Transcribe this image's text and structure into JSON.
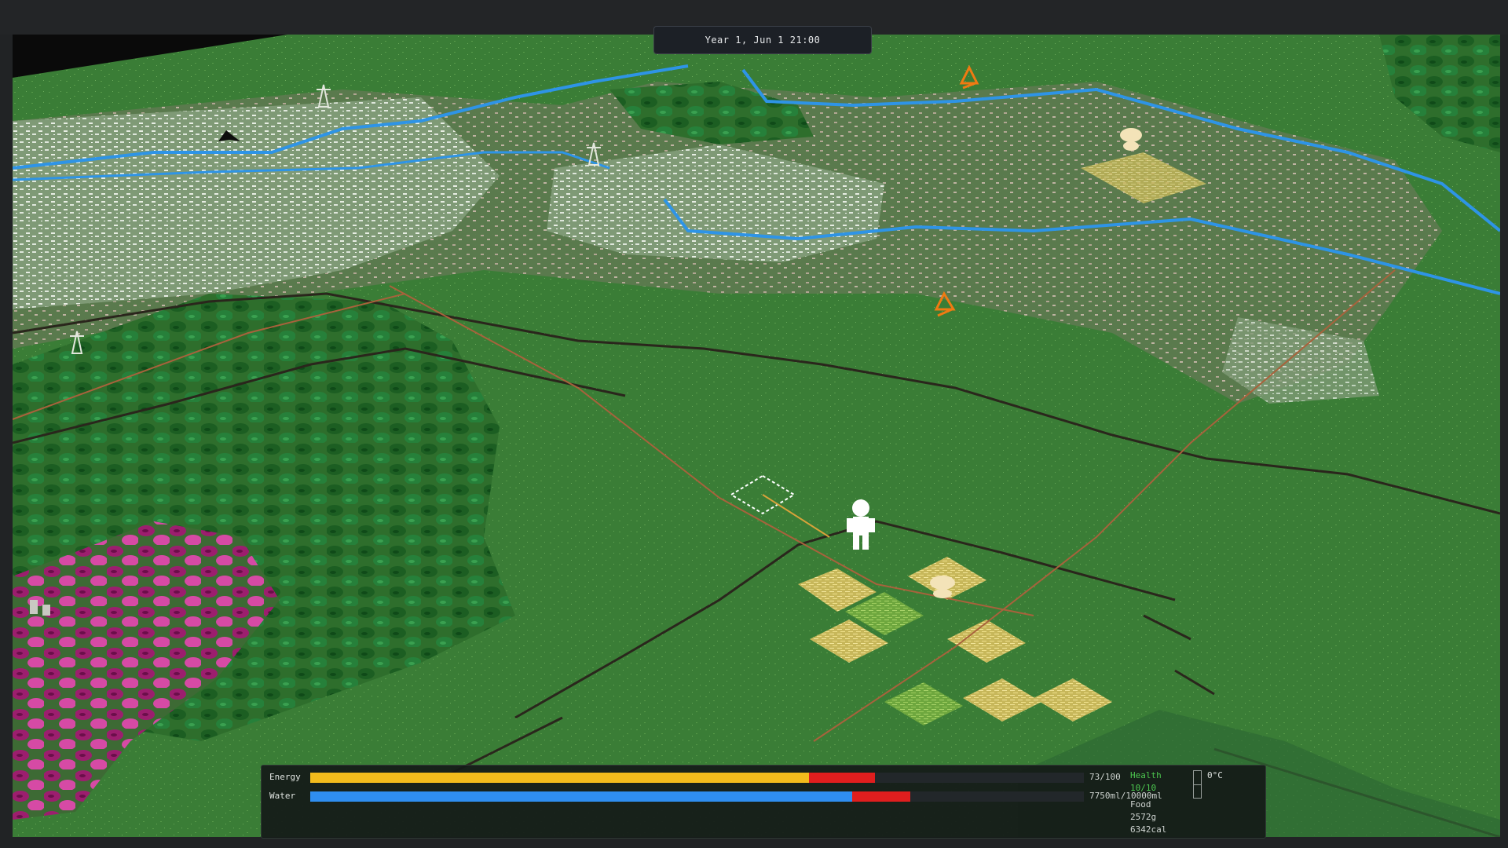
{
  "clock": {
    "text": "Year 1, Jun 1  21:00"
  },
  "hud": {
    "energy": {
      "label": "Energy",
      "value_text": "73/100",
      "fraction": 0.73,
      "pending_loss_fraction": 0.085,
      "color": "#f2bb1c"
    },
    "water": {
      "label": "Water",
      "value_text": "7750ml/10000ml",
      "fraction": 0.775,
      "pending_loss_fraction": 0.075,
      "color": "#2f8ef0"
    },
    "health": {
      "label": "Health",
      "value": "10/10",
      "color": "#4cc74f"
    },
    "food": {
      "label": "Food",
      "grams": "2572g",
      "calories": "6342cal"
    },
    "temperature": {
      "value": "0°C"
    }
  },
  "map": {
    "player": {
      "icon": "human-figure-icon",
      "color": "#ffffff"
    },
    "cursor": {
      "icon": "tile-selection-cursor-icon"
    },
    "icons": [
      "pylon-icon",
      "pylon-icon",
      "pylon-icon",
      "crow-icon",
      "campfire-icon",
      "campfire-icon",
      "mushroom-icon",
      "mushroom-icon",
      "stone-ruin-icon"
    ],
    "terrain_colors": {
      "grass": "#3b7f37",
      "forest": "#1d6a28",
      "blossom": "#c2348f",
      "snow_field": "#c9d5c4",
      "river": "#2e94e6",
      "wheat": "#e3d27a",
      "cliff": "#2a261c"
    }
  }
}
